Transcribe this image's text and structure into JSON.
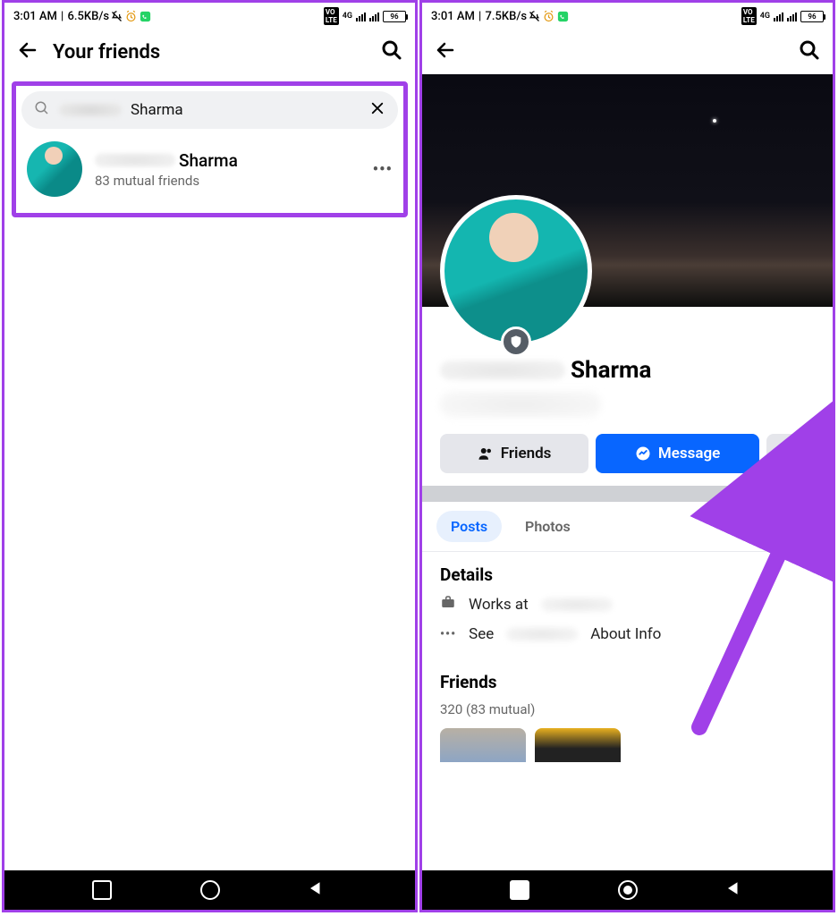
{
  "left": {
    "status": {
      "time": "3:01 AM",
      "speed": "6.5KB/s",
      "net": "4G",
      "battery": "96"
    },
    "header": {
      "title": "Your friends"
    },
    "search": {
      "query_visible": "Sharma"
    },
    "result": {
      "name_visible": "Sharma",
      "mutual": "83 mutual friends"
    }
  },
  "right": {
    "status": {
      "time": "3:01 AM",
      "speed": "7.5KB/s",
      "net": "4G",
      "battery": "96"
    },
    "profile": {
      "name_visible": "Sharma"
    },
    "buttons": {
      "friends": "Friends",
      "message": "Message"
    },
    "tabs": {
      "posts": "Posts",
      "photos": "Photos"
    },
    "details": {
      "title": "Details",
      "works_prefix": "Works at",
      "see_prefix": "See",
      "about_suffix": "About Info"
    },
    "friends": {
      "title": "Friends",
      "count": "320 (83 mutual)"
    }
  }
}
